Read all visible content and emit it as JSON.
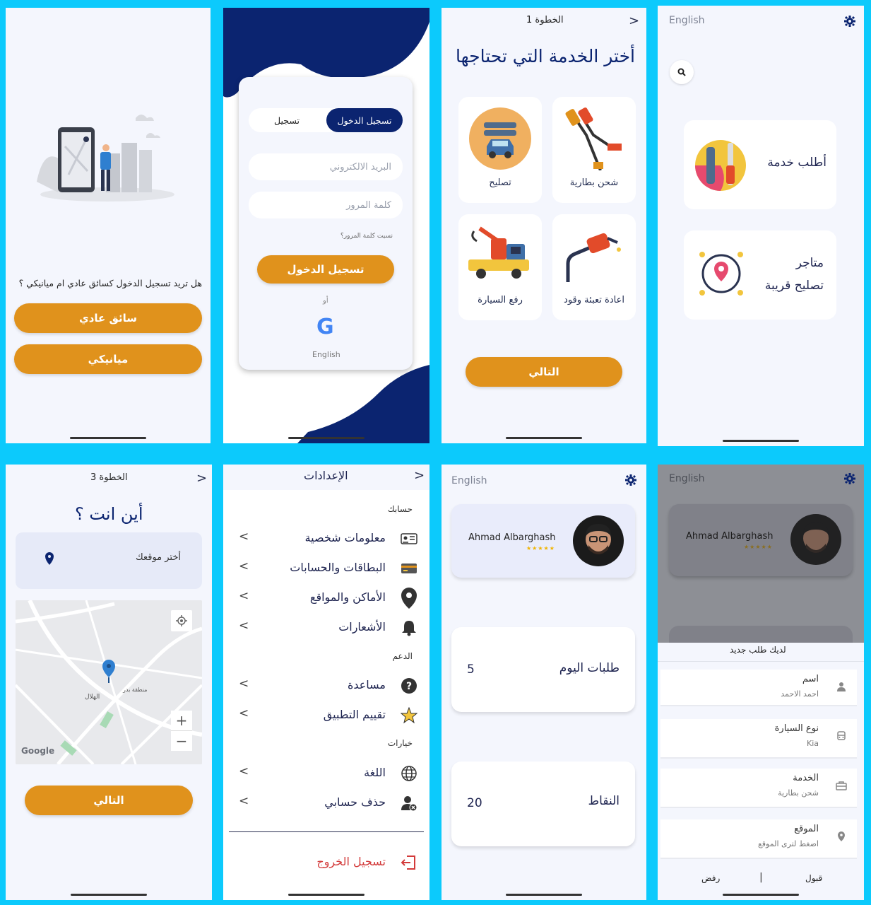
{
  "screen1": {
    "question": "هل تريد تسجيل الدخول كسائق عادي ام ميانيكي ؟",
    "btn_driver": "سائق عادي",
    "btn_mechanic": "ميانيكي"
  },
  "screen2": {
    "tab_login": "تسجيل الدخول",
    "tab_register": "تسجيل",
    "email_placeholder": "البريد الالكتروني",
    "password_placeholder": "كلمة المرور",
    "forgot": "نسيت كلمة المرور؟",
    "login_button": "تسجيل الدخول",
    "or": "أو",
    "google_letter": "G",
    "lang": "English"
  },
  "screen3": {
    "step": "الخطوة 1",
    "title": "أختر الخدمة التي تحتاجها",
    "services": [
      "تصليح",
      "شحن بطارية",
      "رفع السيارة",
      "اعادة تعبئة وقود"
    ],
    "next": "التالي"
  },
  "screen4": {
    "lang": "English",
    "card1": "أطلب خدمة",
    "card2_line1": "متاجر",
    "card2_line2": "تصليح قريبة"
  },
  "screen5": {
    "step": "الخطوة 3",
    "title": "أين انت ؟",
    "choose_location": "أختر موقعك",
    "google": "Google",
    "zoom_in": "+",
    "zoom_out": "−",
    "map_labels": [
      "الهلال",
      "منطقة بدر"
    ],
    "next": "التالي"
  },
  "screen6": {
    "title": "الإعدادات",
    "section_account": "حسابك",
    "account_items": [
      "معلومات شخصية",
      "البطاقات والحسابات",
      "الأماكن والمواقع",
      "الأشعارات"
    ],
    "section_support": "الدعم",
    "support_items": [
      "مساعدة",
      "تقييم التطبيق"
    ],
    "section_options": "خيارات",
    "option_items": [
      "اللغة",
      "حذف حسابي"
    ],
    "logout": "تسجيل الخروج"
  },
  "screen7": {
    "lang": "English",
    "name": "Ahmad Albarghash",
    "stars": "★★★★★",
    "today_label": "طلبات اليوم",
    "today_value": "5",
    "points_label": "النقاط",
    "points_value": "20"
  },
  "screen8": {
    "lang": "English",
    "name": "Ahmad Albarghash",
    "stars": "★★★★★",
    "sheet_title": "لديك طلب جديد",
    "rows": [
      {
        "label": "اسم",
        "value": "احمد الاحمد"
      },
      {
        "label": "نوع السيارة",
        "value": "Kia"
      },
      {
        "label": "الخدمة",
        "value": "شحن بطارية"
      },
      {
        "label": "الموقع",
        "value": "اضغط لترى الموقع"
      }
    ],
    "accept": "قبول",
    "reject": "رفض",
    "divider": "|"
  },
  "colors": {
    "accent": "#e0921c",
    "navy": "#0b2470",
    "frame": "#0ccafc",
    "screen_bg": "#f4f6fd",
    "logout": "#d33a3a"
  }
}
